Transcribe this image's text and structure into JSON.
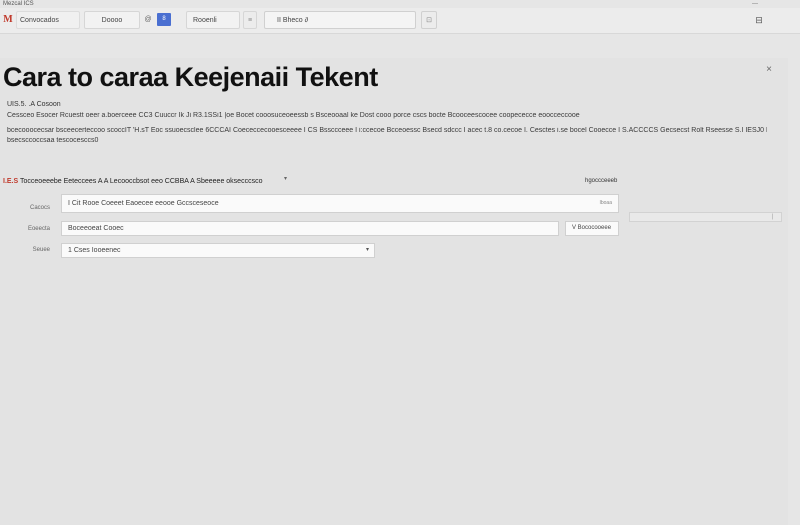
{
  "window": {
    "title": "Mezcal ICS",
    "control": "—"
  },
  "toolbar": {
    "logo": "M",
    "app_name": "Convocados",
    "button": "Doooo",
    "at": "@",
    "blue": "8",
    "lang": "Rooenli",
    "chev": "≡",
    "search": "II Bheco ∂",
    "small": "⊡",
    "menu": "⊟"
  },
  "page": {
    "title": "Cara  to caraa Keejenaii Tekent",
    "close": "×",
    "section_label": "UIS.5. .A  Cosoon",
    "desc_1": "Cessceo  Esocer  Rcuestt oeer a.boerceee CC3 Cuuccr  Ik Ji R3.1SSi1 |oe  Bocet  cooosuceoeessb s Bsceooaal ke  Dost cooo porce  cscs  bocte  Bcooceescocee coopececce eoocceccooe",
    "desc_2": "bcecooocecsar bsceecerteccoo  scoccIT 'H.sT  Eoc ssuoecsclee 6CCCAI  Coececcecooesceeee  I CS Bssccceee I i:ccecoe   Bcceoessc Bsecd sdccc  I acec  t.8 co.cecoe  I. Cesctes  i.se bocel  Cooecce  I S.ACCCCS  Gecsecst  Rolt  Rseesse  S.I IESJ0  BM",
    "desc_3": "bsecsccoccsaa  tescocesccs0"
  },
  "settings": {
    "head_prefix": "I.E.S",
    "head": "Tocceoeeebe  Eeteccees A  A Lecooccbsot eeo CCBBA  A  Sbeeeee oksecccsco",
    "caret": "▾",
    "right_label": "hgoccceeeb",
    "right_hint": "|",
    "rows": [
      {
        "label": "Cacocs",
        "value": "I Cit  Rooe  Coeeet  Eaoecee   eeooe  Gccsceseoce",
        "hint": "Iboaa"
      },
      {
        "label": "Eoeecta",
        "value": "Boceeoeat  Cooec"
      },
      {
        "label": "Seuee",
        "value": "1 Cses  Iooeenec"
      }
    ],
    "row2_extra": "V  Bococooeee",
    "dropdown_icon": "▾"
  }
}
